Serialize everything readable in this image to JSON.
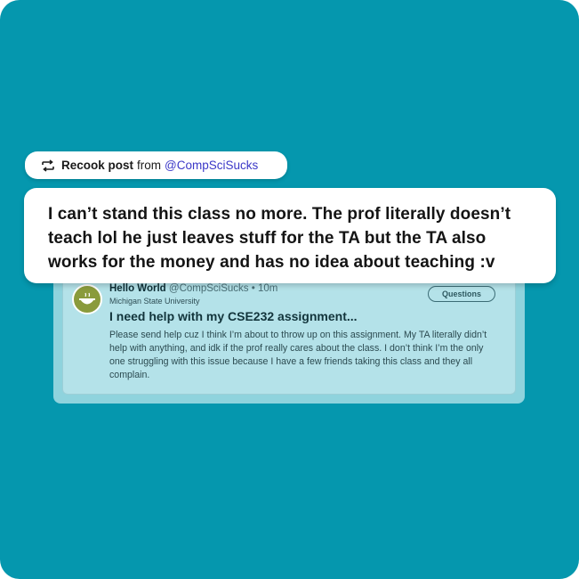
{
  "recook": {
    "label": "Recook post",
    "from": "from",
    "handle": "@CompSciSucks",
    "icon": "repost-arrows-icon"
  },
  "comment": {
    "text": "I can’t stand this class no more. The prof literally doesn’t teach lol he just leaves stuff for the TA but the TA also works for the money and has no idea about teaching :v"
  },
  "quoted_post": {
    "author_name": "Hello World",
    "author_handle": "@CompSciSucks",
    "time": "10m",
    "school": "Michigan State University",
    "tag": "Questions",
    "title": "I need help with my CSE232 assignment...",
    "body": "Please send help cuz I think I’m about to throw up on this assignment. My TA literally didn’t help with anything, and idk if the prof really cares about the class. I don’t think I’m the only one struggling with this issue because I have a few friends taking this class and they all complain.",
    "avatar_icon": "bowl-avatar-icon"
  },
  "colors": {
    "background": "#0597AE",
    "quote_card": "#b4e2e9",
    "handle_link": "#3b38c7"
  }
}
